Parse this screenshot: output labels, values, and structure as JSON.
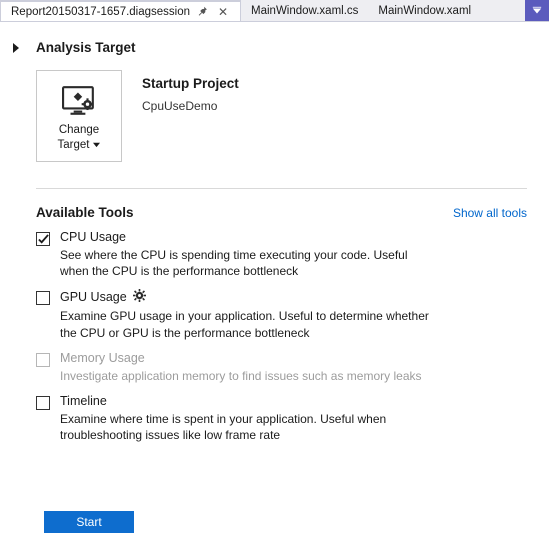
{
  "tabs": {
    "active": "Report20150317-1657.diagsession",
    "others": [
      "MainWindow.xaml.cs",
      "MainWindow.xaml"
    ]
  },
  "section": {
    "title": "Analysis Target"
  },
  "target": {
    "change_line1": "Change",
    "change_line2": "Target",
    "startup_title": "Startup Project",
    "startup_sub": "CpuUseDemo"
  },
  "tools_header": {
    "title": "Available Tools",
    "show_all": "Show all tools"
  },
  "tools": [
    {
      "title": "CPU Usage",
      "desc": "See where the CPU is spending time executing your code. Useful when the CPU is the performance bottleneck",
      "checked": true,
      "enabled": true,
      "gear": false
    },
    {
      "title": "GPU Usage",
      "desc": "Examine GPU usage in your application. Useful to determine whether the CPU or GPU is the performance bottleneck",
      "checked": false,
      "enabled": true,
      "gear": true
    },
    {
      "title": "Memory Usage",
      "desc": "Investigate application memory to find issues such as memory leaks",
      "checked": false,
      "enabled": false,
      "gear": false
    },
    {
      "title": "Timeline",
      "desc": "Examine where time is spent in your application. Useful when troubleshooting issues like low frame rate",
      "checked": false,
      "enabled": true,
      "gear": false
    }
  ],
  "buttons": {
    "start": "Start"
  }
}
